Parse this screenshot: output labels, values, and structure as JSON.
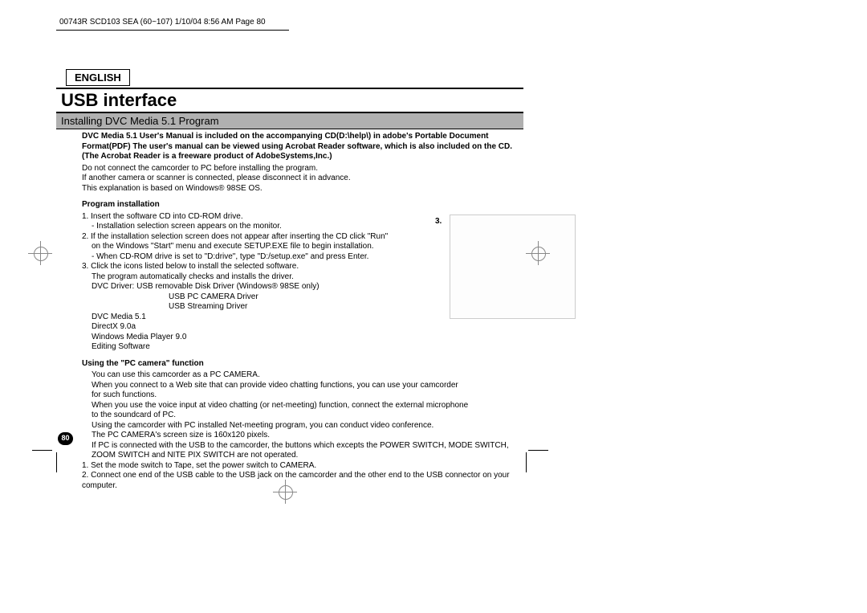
{
  "header": "00743R SCD103 SEA (60~107)  1/10/04 8:56 AM  Page 80",
  "lang": "ENGLISH",
  "title": "USB interface",
  "subtitle": "Installing DVC Media 5.1 Program",
  "intro": {
    "b1": "DVC Media 5.1 User's Manual is included on the accompanying CD(D:\\help\\) in adobe's Portable Document",
    "b2": "Format(PDF) The user's manual can be viewed using Acrobat Reader software, which is also included on the CD.",
    "b3": "(The Acrobat Reader is a freeware product of AdobeSystems,Inc.)",
    "p1": "Do not connect the camcorder to PC before installing the program.",
    "p2": "If another camera or scanner is connected, please disconnect it in advance.",
    "p3": "This explanation is based on Windows® 98SE OS."
  },
  "sec1": {
    "label": "Program installation",
    "i1": "1.  Insert the software CD into CD-ROM drive.",
    "i1a": "-   Installation selection screen appears on the monitor.",
    "i2": "2.  If the installation selection screen does not appear after inserting the CD click \"Run\"",
    "i2a": "on the Windows \"Start\" menu and execute SETUP.EXE file to begin installation.",
    "i2b": "-   When CD-ROM drive is set to \"D:drive\", type \"D:/setup.exe\" and press Enter.",
    "i3": "3.  Click the icons listed below to install the selected software.",
    "i3a": "The program automatically checks and installs the driver.",
    "i3b": "DVC Driver: USB removable Disk Driver (Windows® 98SE only)",
    "i3c": "USB PC CAMERA Driver",
    "i3d": "USB Streaming Driver",
    "i3e": "DVC Media 5.1",
    "i3f": "DirectX 9.0a",
    "i3g": "Windows Media Player 9.0",
    "i3h": "Editing Software"
  },
  "sec2": {
    "label": "Using the \"PC camera\" function",
    "p1": "You can use this camcorder as a PC CAMERA.",
    "p2": "When you connect to a Web site that can provide video chatting functions, you can use your camcorder",
    "p2a": "for such functions.",
    "p3": "When you use the voice input at video chatting (or net-meeting) function, connect the external microphone",
    "p3a": "to the soundcard of PC.",
    "p4": "Using the camcorder with PC installed Net-meeting program, you can conduct video conference.",
    "p5": "The PC CAMERA's screen size is 160x120 pixels.",
    "p6": "If PC is connected with the USB to the camcorder, the buttons which excepts the POWER SWITCH, MODE SWITCH,",
    "p6a": "ZOOM SWITCH and NITE PIX SWITCH are not operated.",
    "n1": "1.  Set the mode switch to Tape, set the power switch to CAMERA.",
    "n2": "2.  Connect one end of the USB cable to the USB jack on the camcorder and the other end to the USB connector on your computer."
  },
  "figLabel": "3.",
  "pageNum": "80"
}
